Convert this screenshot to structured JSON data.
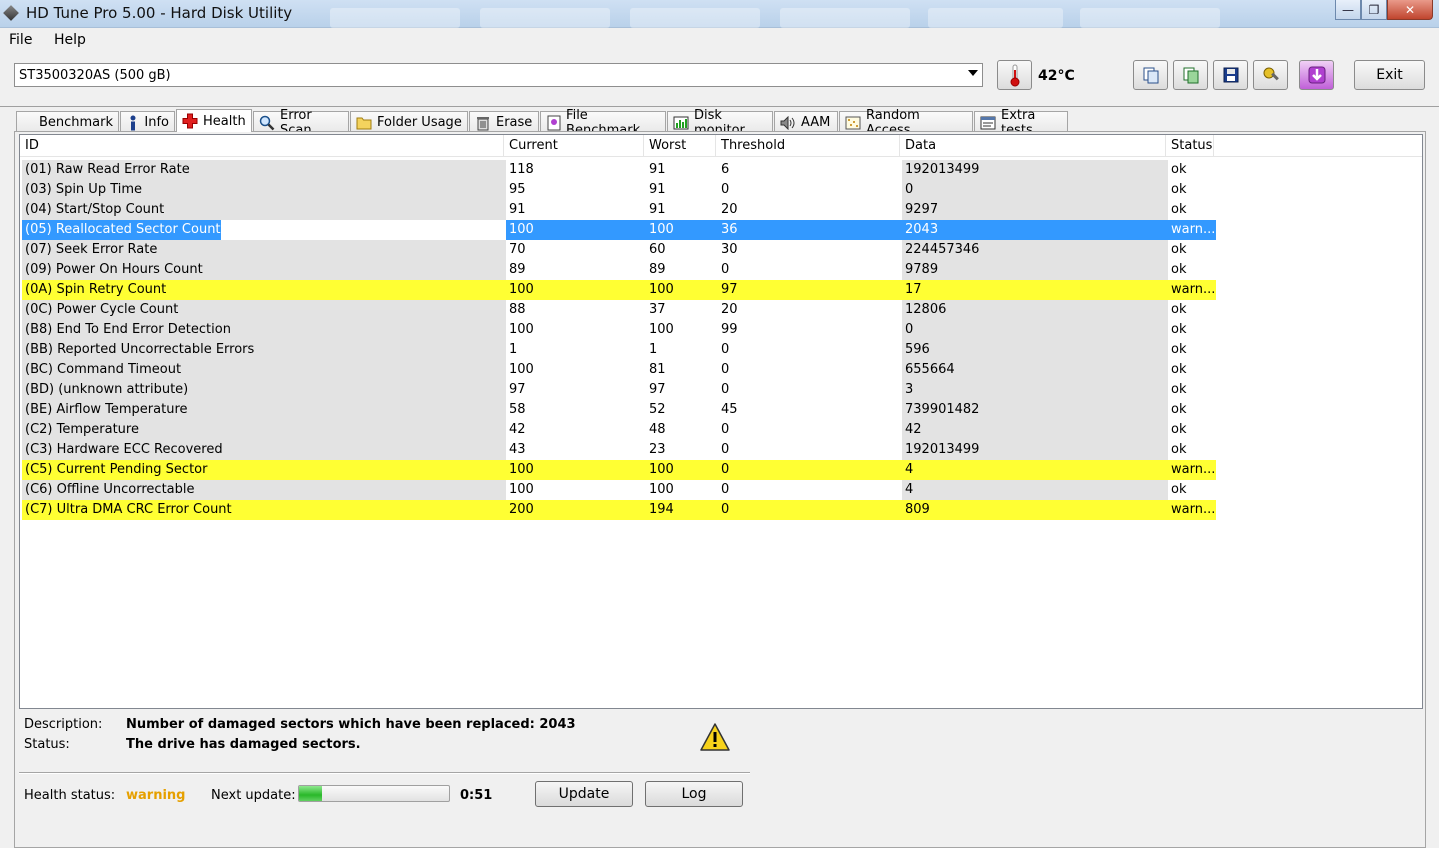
{
  "window": {
    "title": "HD Tune Pro 5.00 - Hard Disk Utility"
  },
  "menu": {
    "file": "File",
    "help": "Help"
  },
  "toolbar": {
    "drive": "ST3500320AS (500 gB)",
    "temperature": "42°C",
    "exit_label": "Exit"
  },
  "tabs": [
    {
      "label": "Benchmark",
      "icon": "benchmark-icon"
    },
    {
      "label": "Info",
      "icon": "info-icon"
    },
    {
      "label": "Health",
      "icon": "health-cross-icon"
    },
    {
      "label": "Error Scan",
      "icon": "magnifier-icon"
    },
    {
      "label": "Folder Usage",
      "icon": "folder-icon"
    },
    {
      "label": "Erase",
      "icon": "trash-icon"
    },
    {
      "label": "File Benchmark",
      "icon": "file-benchmark-icon"
    },
    {
      "label": "Disk monitor",
      "icon": "disk-monitor-icon"
    },
    {
      "label": "AAM",
      "icon": "speaker-icon"
    },
    {
      "label": "Random Access",
      "icon": "random-access-icon"
    },
    {
      "label": "Extra tests",
      "icon": "extra-tests-icon"
    }
  ],
  "active_tab": "Health",
  "table": {
    "headers": {
      "id": "ID",
      "current": "Current",
      "worst": "Worst",
      "threshold": "Threshold",
      "data": "Data",
      "status": "Status"
    },
    "rows": [
      {
        "id": "(01) Raw Read Error Rate",
        "current": "118",
        "worst": "91",
        "threshold": "6",
        "data": "192013499",
        "status": "ok",
        "state": "normal"
      },
      {
        "id": "(03) Spin Up Time",
        "current": "95",
        "worst": "91",
        "threshold": "0",
        "data": "0",
        "status": "ok",
        "state": "normal"
      },
      {
        "id": "(04) Start/Stop Count",
        "current": "91",
        "worst": "91",
        "threshold": "20",
        "data": "9297",
        "status": "ok",
        "state": "normal"
      },
      {
        "id": "(05) Reallocated Sector Count",
        "current": "100",
        "worst": "100",
        "threshold": "36",
        "data": "2043",
        "status": "warn...",
        "state": "selected"
      },
      {
        "id": "(07) Seek Error Rate",
        "current": "70",
        "worst": "60",
        "threshold": "30",
        "data": "224457346",
        "status": "ok",
        "state": "normal"
      },
      {
        "id": "(09) Power On Hours Count",
        "current": "89",
        "worst": "89",
        "threshold": "0",
        "data": "9789",
        "status": "ok",
        "state": "normal"
      },
      {
        "id": "(0A) Spin Retry Count",
        "current": "100",
        "worst": "100",
        "threshold": "97",
        "data": "17",
        "status": "warn...",
        "state": "warning"
      },
      {
        "id": "(0C) Power Cycle Count",
        "current": "88",
        "worst": "37",
        "threshold": "20",
        "data": "12806",
        "status": "ok",
        "state": "normal"
      },
      {
        "id": "(B8) End To End Error Detection",
        "current": "100",
        "worst": "100",
        "threshold": "99",
        "data": "0",
        "status": "ok",
        "state": "normal"
      },
      {
        "id": "(BB) Reported Uncorrectable Errors",
        "current": "1",
        "worst": "1",
        "threshold": "0",
        "data": "596",
        "status": "ok",
        "state": "normal"
      },
      {
        "id": "(BC) Command Timeout",
        "current": "100",
        "worst": "81",
        "threshold": "0",
        "data": "655664",
        "status": "ok",
        "state": "normal"
      },
      {
        "id": "(BD) (unknown attribute)",
        "current": "97",
        "worst": "97",
        "threshold": "0",
        "data": "3",
        "status": "ok",
        "state": "normal"
      },
      {
        "id": "(BE) Airflow Temperature",
        "current": "58",
        "worst": "52",
        "threshold": "45",
        "data": "739901482",
        "status": "ok",
        "state": "normal"
      },
      {
        "id": "(C2) Temperature",
        "current": "42",
        "worst": "48",
        "threshold": "0",
        "data": "42",
        "status": "ok",
        "state": "normal"
      },
      {
        "id": "(C3) Hardware ECC Recovered",
        "current": "43",
        "worst": "23",
        "threshold": "0",
        "data": "192013499",
        "status": "ok",
        "state": "normal"
      },
      {
        "id": "(C5) Current Pending Sector",
        "current": "100",
        "worst": "100",
        "threshold": "0",
        "data": "4",
        "status": "warn...",
        "state": "warning"
      },
      {
        "id": "(C6) Offline Uncorrectable",
        "current": "100",
        "worst": "100",
        "threshold": "0",
        "data": "4",
        "status": "ok",
        "state": "normal"
      },
      {
        "id": "(C7) Ultra DMA CRC Error Count",
        "current": "200",
        "worst": "194",
        "threshold": "0",
        "data": "809",
        "status": "warn...",
        "state": "warning"
      }
    ]
  },
  "details": {
    "description_label": "Description:",
    "description": "Number of damaged sectors which have been replaced: 2043",
    "status_label": "Status:",
    "status": "The drive has damaged sectors."
  },
  "footer": {
    "health_label": "Health status:",
    "health_value": "warning",
    "health_color": "#e6a000",
    "next_update_label": "Next update:",
    "progress": 0.15,
    "countdown": "0:51",
    "update_label": "Update",
    "log_label": "Log"
  },
  "colors": {
    "selection": "#3399ff",
    "warning_row": "#ffff33"
  }
}
